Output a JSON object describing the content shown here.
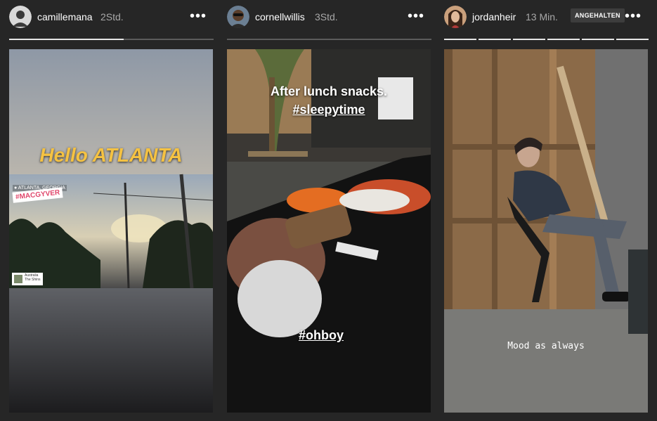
{
  "stories": [
    {
      "username": "camillemana",
      "time": "2Std.",
      "menu": "•••",
      "progress": 0.56,
      "caption": "Hello ATLANTA",
      "sticker_location": "● ATLANTA, GEORGIA",
      "sticker_hashtag": "#MACGYVER",
      "song_title": "Australia",
      "song_artist": "The Shins"
    },
    {
      "username": "cornellwillis",
      "time": "3Std.",
      "menu": "•••",
      "caption_line1": "After lunch snacks.",
      "caption_line2": "#sleepytime",
      "caption_bottom": "#ohboy"
    },
    {
      "username": "jordanheir",
      "time": "13 Min.",
      "badge": "ANGEHALTEN",
      "menu": "•••",
      "segments": 6,
      "caption": "Mood as always"
    }
  ],
  "colors": {
    "background": "#262626",
    "accent_yellow": "#f5c242"
  }
}
